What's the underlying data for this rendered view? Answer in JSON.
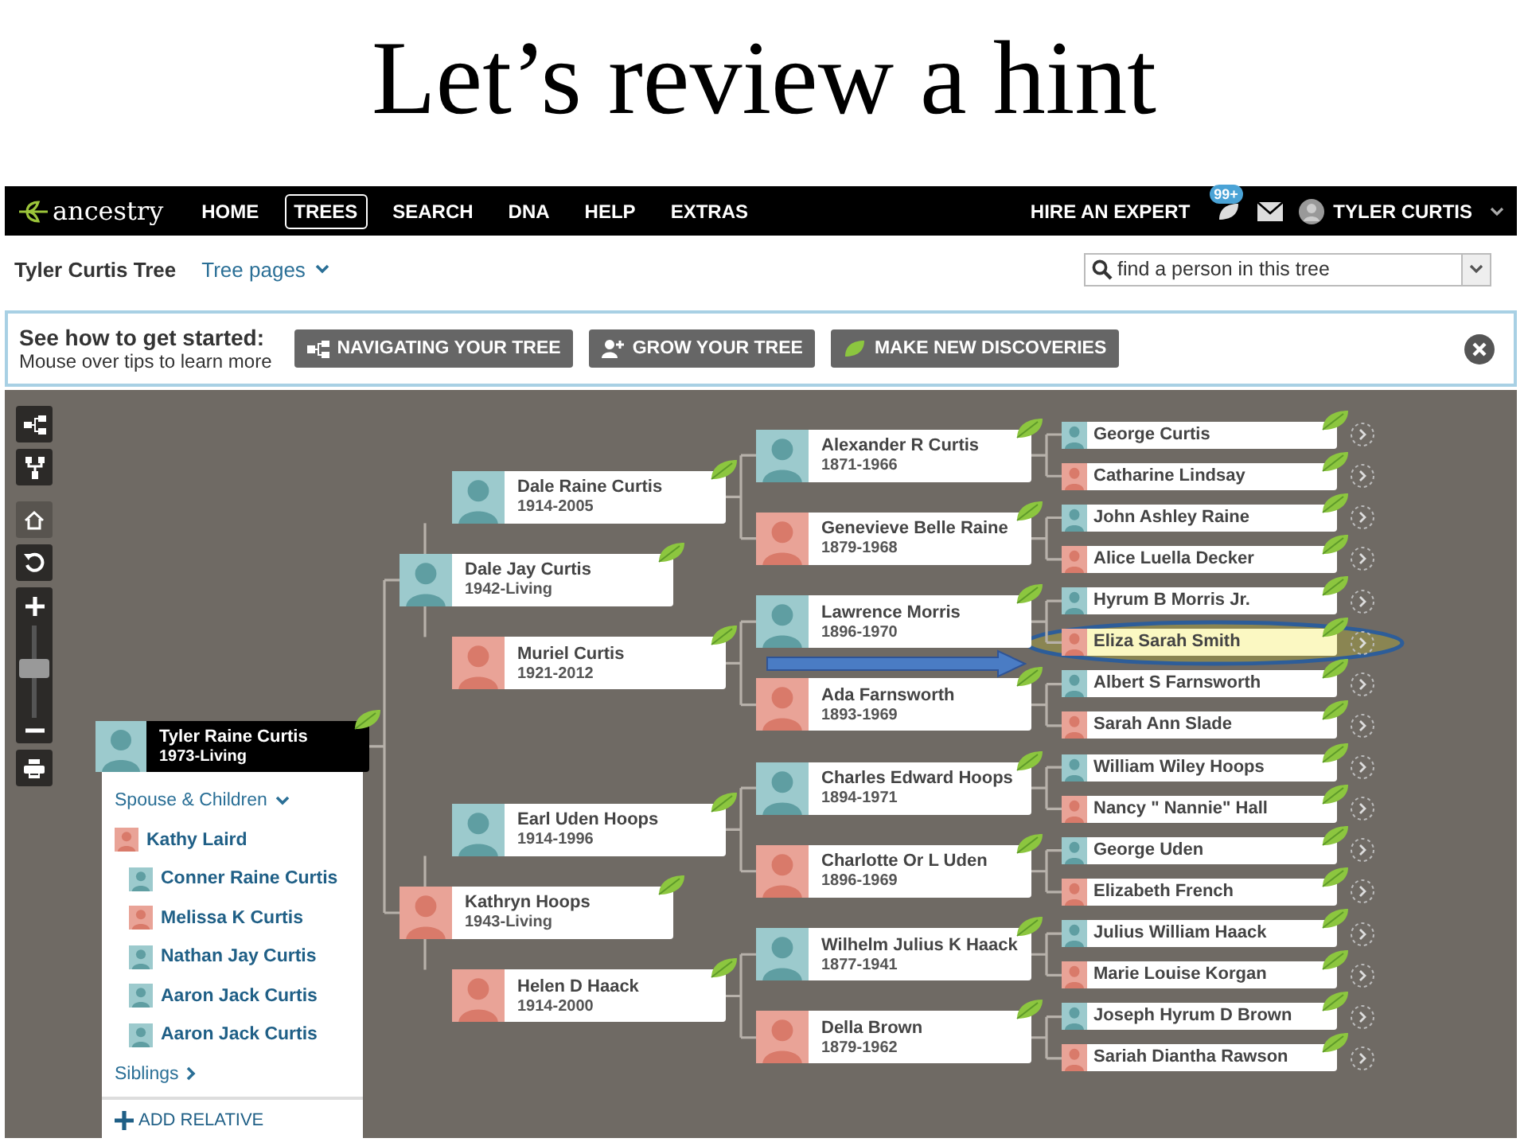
{
  "slide_title": "Let’s review a hint",
  "nav": {
    "logo": "ancestry",
    "items": [
      {
        "label": "HOME",
        "selected": false
      },
      {
        "label": "TREES",
        "selected": true
      },
      {
        "label": "SEARCH",
        "selected": false
      },
      {
        "label": "DNA",
        "selected": false
      },
      {
        "label": "HELP",
        "selected": false
      },
      {
        "label": "EXTRAS",
        "selected": false
      }
    ],
    "hire": "HIRE AN EXPERT",
    "badge": "99+",
    "user": "TYLER CURTIS"
  },
  "subbar": {
    "tree_name": "Tyler Curtis Tree",
    "tree_pages": "Tree pages",
    "search": {
      "placeholder": "find a person in this tree"
    }
  },
  "banner": {
    "title": "See how to get started:",
    "subtitle": "Mouse over tips to learn more",
    "buttons": [
      {
        "label": "NAVIGATING YOUR TREE",
        "kind": "navigate"
      },
      {
        "label": "GROW YOUR TREE",
        "kind": "grow"
      },
      {
        "label": "MAKE NEW DISCOVERIES",
        "kind": "discover"
      }
    ]
  },
  "toolbar": {
    "zoom": {
      "level": 0.5
    }
  },
  "tree": {
    "name": "Tyler Raine Curtis",
    "dates": "1973-Living",
    "kind": "male",
    "hint": true,
    "highlighted": false,
    "children": [
      {
        "name": "Dale Jay Curtis",
        "dates": "1942-Living",
        "kind": "male",
        "hint": true,
        "highlighted": false,
        "children": [
          {
            "name": "Dale Raine Curtis",
            "dates": "1914-2005",
            "kind": "male",
            "hint": true,
            "highlighted": false,
            "children": [
              {
                "name": "Alexander R Curtis",
                "dates": "1871-1966",
                "kind": "male",
                "hint": true,
                "highlighted": false,
                "children": [
                  {
                    "name": "George Curtis",
                    "kind": "male",
                    "hint": true,
                    "highlighted": false
                  },
                  {
                    "name": "Catharine Lindsay",
                    "kind": "female",
                    "hint": true,
                    "highlighted": false
                  }
                ]
              },
              {
                "name": "Genevieve Belle Raine",
                "dates": "1879-1968",
                "kind": "female",
                "hint": true,
                "highlighted": false,
                "children": [
                  {
                    "name": "John Ashley Raine",
                    "kind": "male",
                    "hint": true,
                    "highlighted": false
                  },
                  {
                    "name": "Alice Luella Decker",
                    "kind": "female",
                    "hint": true,
                    "highlighted": false
                  }
                ]
              }
            ]
          },
          {
            "name": "Muriel Curtis",
            "dates": "1921-2012",
            "kind": "female",
            "hint": true,
            "highlighted": false,
            "children": [
              {
                "name": "Lawrence Morris",
                "dates": "1896-1970",
                "kind": "male",
                "hint": true,
                "highlighted": false,
                "children": [
                  {
                    "name": "Hyrum B Morris Jr.",
                    "kind": "male",
                    "hint": true,
                    "highlighted": false
                  },
                  {
                    "name": "Eliza Sarah Smith",
                    "kind": "female",
                    "hint": true,
                    "highlighted": true
                  }
                ]
              },
              {
                "name": "Ada Farnsworth",
                "dates": "1893-1969",
                "kind": "female",
                "hint": true,
                "highlighted": false,
                "children": [
                  {
                    "name": "Albert S Farnsworth",
                    "kind": "male",
                    "hint": true,
                    "highlighted": false
                  },
                  {
                    "name": "Sarah Ann Slade",
                    "kind": "female",
                    "hint": true,
                    "highlighted": false
                  }
                ]
              }
            ]
          }
        ]
      },
      {
        "name": "Kathryn Hoops",
        "dates": "1943-Living",
        "kind": "female",
        "hint": true,
        "highlighted": false,
        "children": [
          {
            "name": "Earl Uden Hoops",
            "dates": "1914-1996",
            "kind": "male",
            "hint": true,
            "highlighted": false,
            "children": [
              {
                "name": "Charles Edward Hoops",
                "dates": "1894-1971",
                "kind": "male",
                "hint": true,
                "highlighted": false,
                "children": [
                  {
                    "name": "William Wiley Hoops",
                    "kind": "male",
                    "hint": true,
                    "highlighted": false
                  },
                  {
                    "name": "Nancy \" Nannie\" Hall",
                    "kind": "female",
                    "hint": true,
                    "highlighted": false
                  }
                ]
              },
              {
                "name": "Charlotte Or L Uden",
                "dates": "1896-1969",
                "kind": "female",
                "hint": true,
                "highlighted": false,
                "children": [
                  {
                    "name": "George Uden",
                    "kind": "male",
                    "hint": true,
                    "highlighted": false
                  },
                  {
                    "name": "Elizabeth French",
                    "kind": "female",
                    "hint": true,
                    "highlighted": false
                  }
                ]
              }
            ]
          },
          {
            "name": "Helen D Haack",
            "dates": "1914-2000",
            "kind": "female",
            "hint": true,
            "highlighted": false,
            "children": [
              {
                "name": "Wilhelm Julius K Haack",
                "dates": "1877-1941",
                "kind": "male",
                "hint": true,
                "highlighted": false,
                "children": [
                  {
                    "name": "Julius William Haack",
                    "kind": "male",
                    "hint": true,
                    "highlighted": false
                  },
                  {
                    "name": "Marie Louise Korgan",
                    "kind": "female",
                    "hint": true,
                    "highlighted": false
                  }
                ]
              },
              {
                "name": "Della Brown",
                "dates": "1879-1962",
                "kind": "female",
                "hint": true,
                "highlighted": false,
                "children": [
                  {
                    "name": "Joseph Hyrum D Brown",
                    "kind": "male",
                    "hint": true,
                    "highlighted": false
                  },
                  {
                    "name": "Sariah Diantha Rawson",
                    "kind": "female",
                    "hint": true,
                    "highlighted": false
                  }
                ]
              }
            ]
          }
        ]
      }
    ]
  },
  "family": {
    "heading": "Spouse & Children",
    "spouse": {
      "name": "Kathy Laird",
      "kind": "female"
    },
    "children": [
      {
        "name": "Conner Raine Curtis",
        "kind": "male"
      },
      {
        "name": "Melissa K Curtis",
        "kind": "female"
      },
      {
        "name": "Nathan Jay Curtis",
        "kind": "male"
      },
      {
        "name": "Aaron Jack Curtis",
        "kind": "male"
      },
      {
        "name": "Aaron Jack Curtis",
        "kind": "male"
      }
    ],
    "siblings": "Siblings",
    "add": "ADD RELATIVE"
  }
}
